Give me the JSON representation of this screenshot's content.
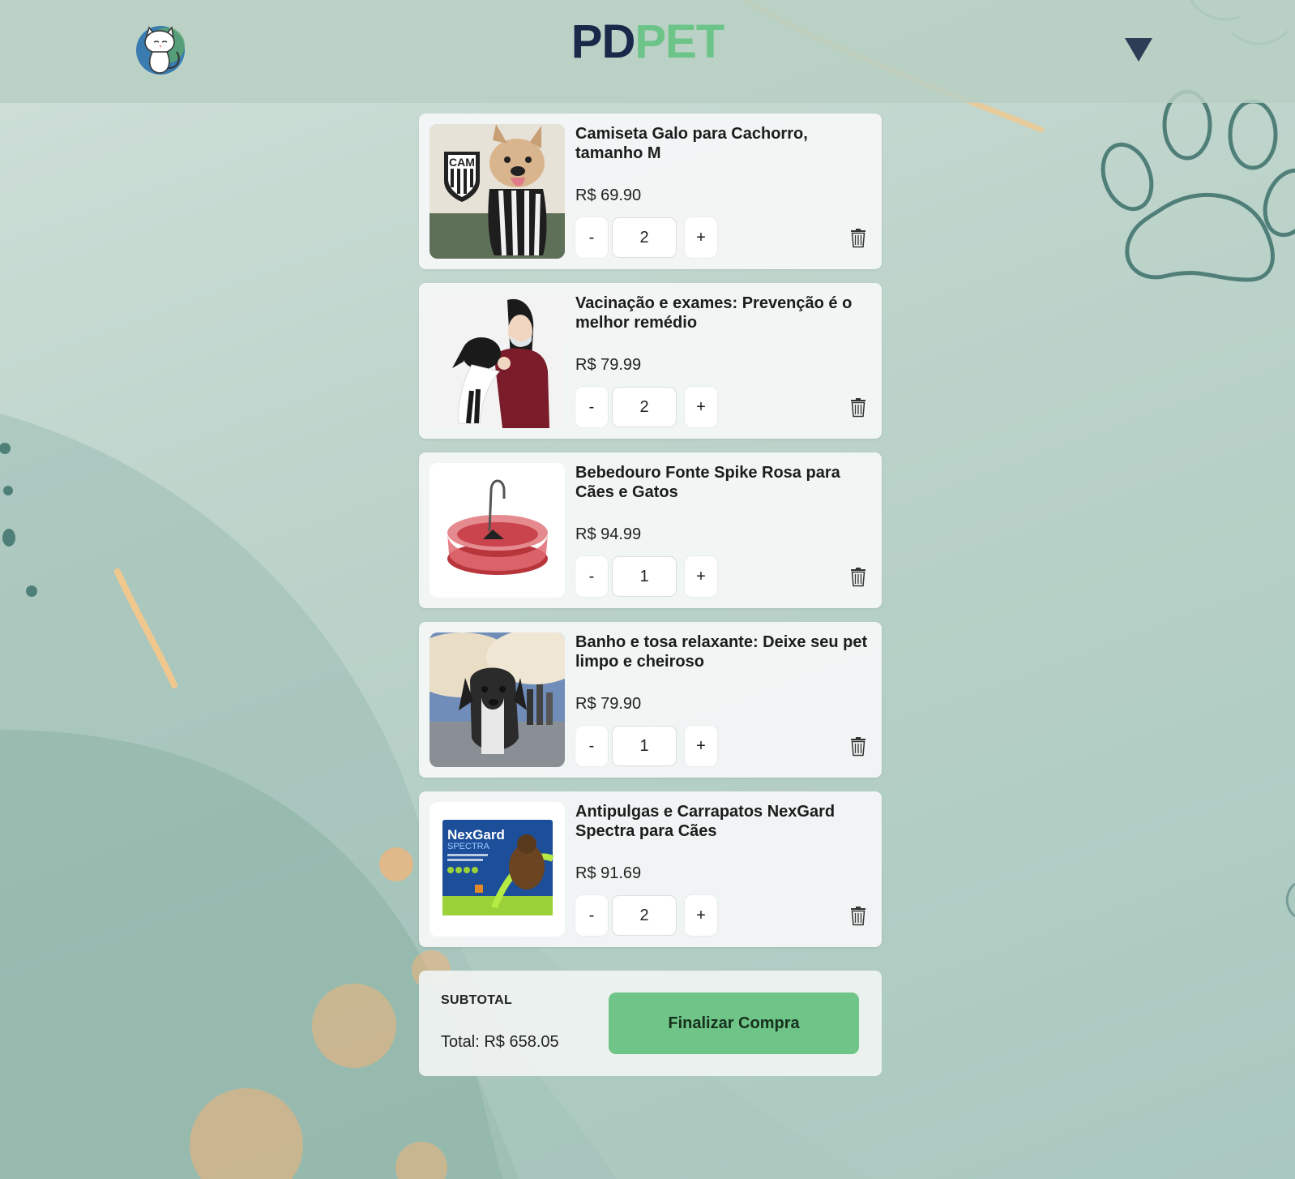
{
  "header": {
    "brand_part1": "PD",
    "brand_part2": "PET",
    "logo_icon": "cat-logo-icon",
    "menu_icon": "dropdown-triangle-icon"
  },
  "cart": {
    "items": [
      {
        "title": "Camiseta Galo para Cachorro, tamanho M",
        "price": "R$ 69.90",
        "quantity": "2",
        "minus_label": "-",
        "plus_label": "+"
      },
      {
        "title": "Vacinação e exames: Prevenção é o melhor remédio",
        "price": "R$ 79.99",
        "quantity": "2",
        "minus_label": "-",
        "plus_label": "+"
      },
      {
        "title": "Bebedouro Fonte Spike Rosa para Cães e Gatos",
        "price": "R$ 94.99",
        "quantity": "1",
        "minus_label": "-",
        "plus_label": "+"
      },
      {
        "title": "Banho e tosa relaxante: Deixe seu pet limpo e cheiroso",
        "price": "R$ 79.90",
        "quantity": "1",
        "minus_label": "-",
        "plus_label": "+"
      },
      {
        "title": "Antipulgas e Carrapatos NexGard Spectra para Cães",
        "price": "R$ 91.69",
        "quantity": "2",
        "minus_label": "-",
        "plus_label": "+"
      }
    ]
  },
  "summary": {
    "subtotal_label": "SUBTOTAL",
    "total_text": "Total: R$ 658.05",
    "checkout_label": "Finalizar Compra"
  },
  "product_image_text": {
    "shirt_crest": "CAM",
    "nexgard_brand": "NexGard",
    "nexgard_line": "SPECTRA"
  },
  "colors": {
    "brand_dark": "#18294a",
    "brand_green": "#6cc488",
    "checkout_button": "#6fc587",
    "paw_outline": "#4f7f78"
  }
}
